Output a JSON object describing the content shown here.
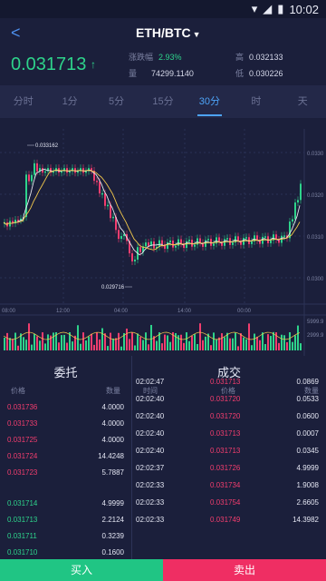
{
  "status": {
    "time": "10:02"
  },
  "header": {
    "pair": "ETH/BTC",
    "price": "0.031713",
    "change_label": "涨跌幅",
    "change_value": "2.93%",
    "high_label": "高",
    "high_value": "0.032133",
    "volume_label": "量",
    "volume_value": "74299.1140",
    "low_label": "低",
    "low_value": "0.030226"
  },
  "tabs": [
    "分时",
    "1分",
    "5分",
    "15分",
    "30分",
    "时",
    "天"
  ],
  "active_tab": 4,
  "chart_data": {
    "type": "candlestick",
    "max_label": "0.033162",
    "min_label": "0.029716",
    "price_ticks": [
      "0.0330",
      "0.0320",
      "0.0310",
      "0.0300"
    ],
    "time_ticks": [
      "08:00",
      "12:00",
      "04:00",
      "14:00",
      "00:00"
    ],
    "volume_ticks": [
      "5999.9",
      "2999.9"
    ]
  },
  "orders": {
    "title": "委托",
    "col_price": "价格",
    "col_qty": "数量",
    "asks": [
      {
        "price": "0.031736",
        "qty": "4.0000"
      },
      {
        "price": "0.031733",
        "qty": "4.0000"
      },
      {
        "price": "0.031725",
        "qty": "4.0000"
      },
      {
        "price": "0.031724",
        "qty": "14.4248"
      },
      {
        "price": "0.031723",
        "qty": "5.7887"
      }
    ],
    "bids": [
      {
        "price": "0.031714",
        "qty": "4.9999"
      },
      {
        "price": "0.031713",
        "qty": "2.2124"
      },
      {
        "price": "0.031711",
        "qty": "0.3239"
      },
      {
        "price": "0.031710",
        "qty": "0.1600"
      }
    ]
  },
  "trades": {
    "title": "成交",
    "col_time": "时间",
    "col_price": "价格",
    "col_qty": "数量",
    "rows": [
      {
        "time": "02:02:47",
        "price": "0.031713",
        "qty": "0.0869"
      },
      {
        "time": "02:02:40",
        "price": "0.031720",
        "qty": "0.0533"
      },
      {
        "time": "02:02:40",
        "price": "0.031720",
        "qty": "0.0600"
      },
      {
        "time": "02:02:40",
        "price": "0.031713",
        "qty": "0.0007"
      },
      {
        "time": "02:02:40",
        "price": "0.031713",
        "qty": "0.0345"
      },
      {
        "time": "02:02:37",
        "price": "0.031726",
        "qty": "4.9999"
      },
      {
        "time": "02:02:33",
        "price": "0.031734",
        "qty": "1.9008"
      },
      {
        "time": "02:02:33",
        "price": "0.031754",
        "qty": "2.6605"
      },
      {
        "time": "02:02:33",
        "price": "0.031749",
        "qty": "14.3982"
      }
    ]
  },
  "actions": {
    "buy": "买入",
    "sell": "卖出"
  },
  "colors": {
    "up": "#2ed38b",
    "down": "#f23d6e",
    "accent": "#4da3f7"
  }
}
